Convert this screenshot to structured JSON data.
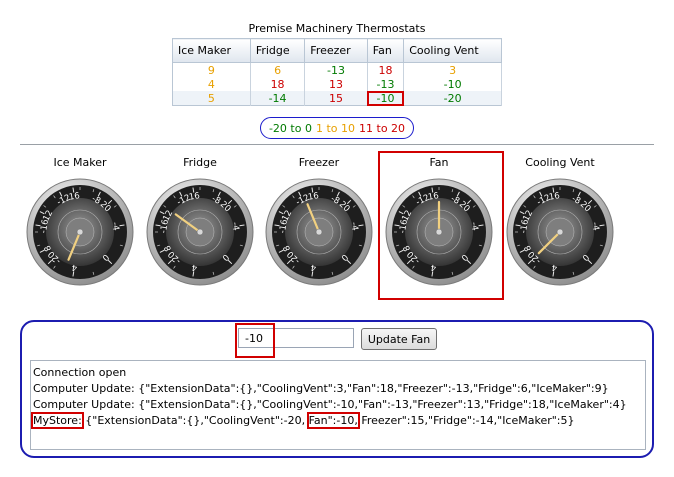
{
  "title": "Premise Machinery Thermostats",
  "table": {
    "columns": [
      "Ice Maker",
      "Fridge",
      "Freezer",
      "Fan",
      "Cooling Vent"
    ],
    "rows": [
      [
        9,
        6,
        -13,
        18,
        3
      ],
      [
        4,
        18,
        13,
        -13,
        -10
      ],
      [
        5,
        -14,
        15,
        -10,
        -20
      ]
    ]
  },
  "legend": {
    "green": "-20 to 0",
    "orange": "1 to 10",
    "red": "11 to 20"
  },
  "colors": {
    "green": "#007a00",
    "orange": "#e8a000",
    "red": "#cc0000",
    "highlight": "#d10000",
    "panel_border": "#1c1cb0"
  },
  "gauges": [
    {
      "label": "Ice Maker",
      "value": 5
    },
    {
      "label": "Fridge",
      "value": -14
    },
    {
      "label": "Freezer",
      "value": 15
    },
    {
      "label": "Fan",
      "value": -10
    },
    {
      "label": "Cooling Vent",
      "value": -20
    }
  ],
  "gauge_ticks": [
    "-20",
    "-16",
    "-12",
    "-8",
    "-4",
    "0",
    "4",
    "8",
    "12",
    "16",
    "20"
  ],
  "control": {
    "value": "-10",
    "button_label": "Update Fan"
  },
  "log": {
    "line1": "Connection open",
    "line2": "Computer Update: {\"ExtensionData\":{},\"CoolingVent\":3,\"Fan\":18,\"Freezer\":-13,\"Fridge\":6,\"IceMaker\":9}",
    "line3": "Computer Update: {\"ExtensionData\":{},\"CoolingVent\":-10,\"Fan\":-13,\"Freezer\":13,\"Fridge\":18,\"IceMaker\":4}",
    "line4_store": "MyStore:",
    "line4_a": " {\"ExtensionData\":{},\"CoolingVent\":-20, ",
    "line4_fan": "Fan\":-10,",
    "line4_b": " Freezer\":15,\"Fridge\":-14,\"IceMaker\":5}"
  }
}
